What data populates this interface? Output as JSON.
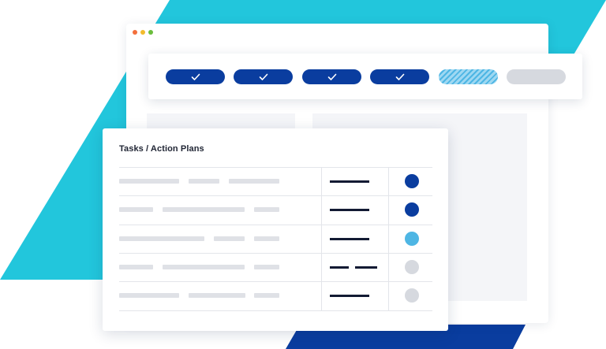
{
  "colors": {
    "accent_cyan": "#22c6dc",
    "brand_blue": "#0a3d9f",
    "light_blue": "#4eb6e4",
    "inactive_grey": "#d6d9df",
    "text_dark": "#121a33"
  },
  "window": {
    "traffic_lights": [
      "#f36f3b",
      "#f2bb2c",
      "#6bbd3c"
    ]
  },
  "stepper": {
    "steps": [
      {
        "state": "complete",
        "icon": "check-icon"
      },
      {
        "state": "complete",
        "icon": "check-icon"
      },
      {
        "state": "complete",
        "icon": "check-icon"
      },
      {
        "state": "complete",
        "icon": "check-icon"
      },
      {
        "state": "in-progress"
      },
      {
        "state": "not-started"
      }
    ]
  },
  "tasks": {
    "title": "Tasks / Action Plans",
    "rows": [
      {
        "status": "complete"
      },
      {
        "status": "complete"
      },
      {
        "status": "in-progress"
      },
      {
        "status": "not-started"
      },
      {
        "status": "not-started"
      }
    ]
  }
}
